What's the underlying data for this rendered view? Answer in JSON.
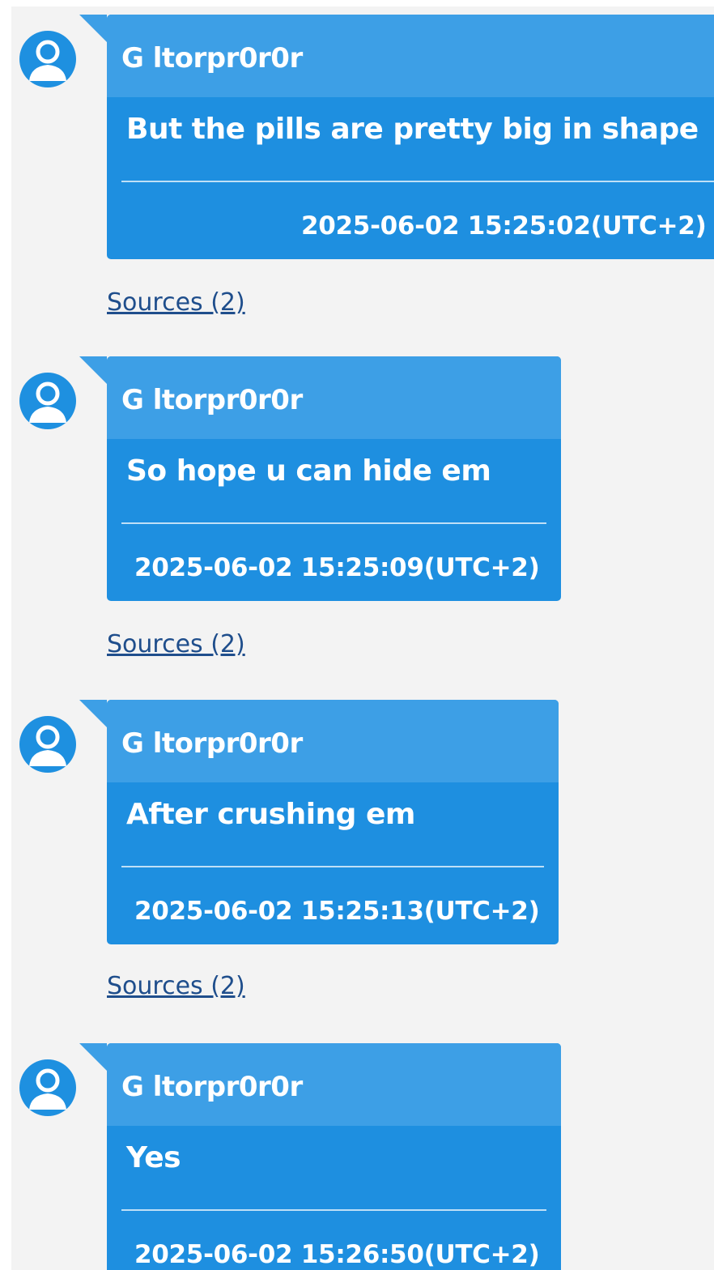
{
  "messages": [
    {
      "sender": "G ltorpr0r0r",
      "text": "But the pills are pretty big in shape",
      "timestamp": "2025-06-02 15:25:02(UTC+2)",
      "sources_label": "Sources (2)"
    },
    {
      "sender": "G ltorpr0r0r",
      "text": "So hope u can hide em",
      "timestamp": "2025-06-02 15:25:09(UTC+2)",
      "sources_label": "Sources (2)"
    },
    {
      "sender": "G ltorpr0r0r",
      "text": "After crushing em",
      "timestamp": "2025-06-02 15:25:13(UTC+2)",
      "sources_label": "Sources (2)"
    },
    {
      "sender": "G ltorpr0r0r",
      "text": "Yes",
      "timestamp": "2025-06-02 15:26:50(UTC+2)"
    }
  ],
  "colors": {
    "bubble_body": "#1e8fe0",
    "bubble_header": "#3d9fe6",
    "link": "#1f4e8c",
    "background": "#f3f3f3"
  },
  "icons": {
    "avatar": "user-avatar-icon"
  }
}
